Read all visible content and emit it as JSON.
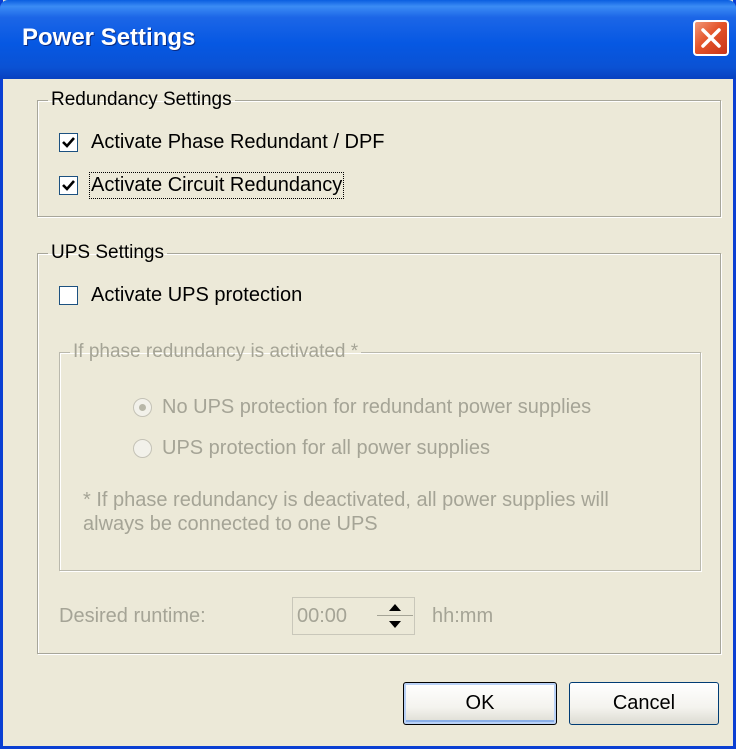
{
  "window": {
    "title": "Power Settings",
    "close_icon": "close-icon"
  },
  "redundancy": {
    "legend": "Redundancy Settings",
    "phase_redundant": {
      "label": "Activate Phase Redundant / DPF",
      "checked": true
    },
    "circuit_redundancy": {
      "label": "Activate Circuit Redundancy",
      "checked": true
    }
  },
  "ups": {
    "legend": "UPS Settings",
    "activate_ups": {
      "label": "Activate UPS protection",
      "checked": false
    },
    "phase_group": {
      "legend": "If phase redundancy is activated *",
      "options": [
        {
          "label": "No UPS protection for redundant power supplies",
          "selected": true
        },
        {
          "label": "UPS protection for all power supplies",
          "selected": false
        }
      ],
      "note": "* If phase redundancy is deactivated, all power supplies will always be connected to one UPS"
    },
    "runtime": {
      "label": "Desired runtime:",
      "value": "00:00",
      "unit": "hh:mm"
    }
  },
  "buttons": {
    "ok": "OK",
    "cancel": "Cancel"
  },
  "colors": {
    "title_bar": "#0658e3",
    "dialog_bg": "#ece9d8",
    "disabled_text": "#a5a496",
    "close_button": "#e4542a"
  }
}
